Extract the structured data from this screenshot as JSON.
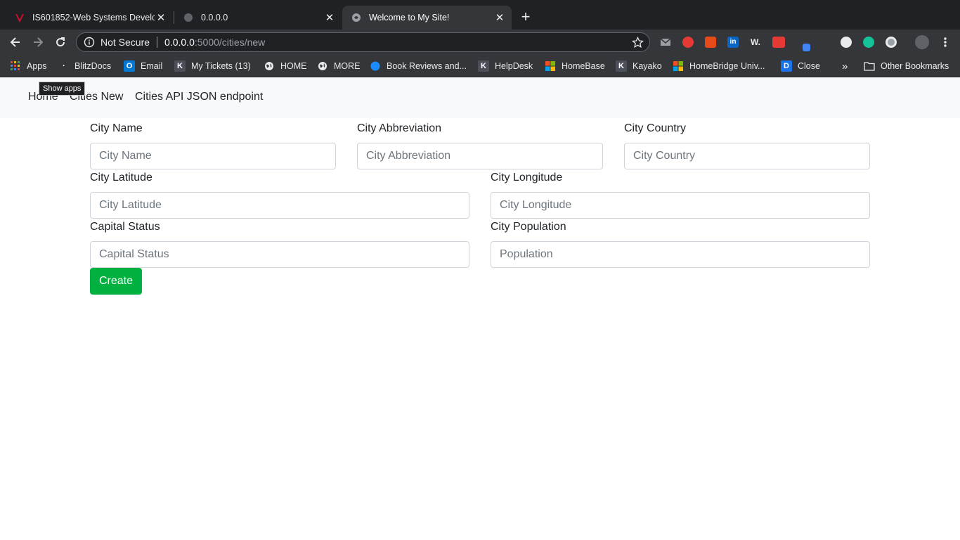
{
  "browser": {
    "tabs": [
      {
        "title": "IS601852-Web Systems Develo",
        "close": "✕"
      },
      {
        "title": "0.0.0.0",
        "close": "✕"
      },
      {
        "title": "Welcome to My Site!",
        "close": "✕"
      }
    ],
    "new_tab_symbol": "+",
    "address": {
      "security": "Not Secure",
      "host": "0.0.0.0",
      "rest": ":5000/cities/new"
    },
    "icons": [
      "back-icon",
      "forward-icon",
      "reload-icon",
      "info-icon",
      "star-icon",
      "menu-icon"
    ],
    "bookmarks": [
      {
        "label": "Apps",
        "icon": "apps-grid-icon"
      },
      {
        "label": "BlitzDocs",
        "icon": "dot-icon"
      },
      {
        "label": "Email",
        "icon": "outlook-icon"
      },
      {
        "label": "My Tickets (13)",
        "icon": "k-icon"
      },
      {
        "label": "HOME",
        "icon": "globe-icon"
      },
      {
        "label": "MORE",
        "icon": "globe-icon"
      },
      {
        "label": "Book Reviews and...",
        "icon": "blue-circle-icon"
      },
      {
        "label": "HelpDesk",
        "icon": "k-icon"
      },
      {
        "label": "HomeBase",
        "icon": "ms-squares-icon"
      },
      {
        "label": "Kayako",
        "icon": "k-icon"
      },
      {
        "label": "HomeBridge Univ...",
        "icon": "ms-squares-icon"
      },
      {
        "label": "Close",
        "icon": "d-icon"
      }
    ],
    "overflow_symbol": "»",
    "other_bookmarks": "Other Bookmarks",
    "tooltip": "Show apps"
  },
  "page": {
    "nav": [
      "Home",
      "Cities New",
      "Cities API JSON endpoint"
    ],
    "form": {
      "city_name": {
        "label": "City Name",
        "placeholder": "City Name"
      },
      "city_abbreviation": {
        "label": "City Abbreviation",
        "placeholder": "City Abbreviation"
      },
      "city_country": {
        "label": "City Country",
        "placeholder": "City Country"
      },
      "city_latitude": {
        "label": "City Latitude",
        "placeholder": "City Latitude"
      },
      "city_longitude": {
        "label": "City Longitude",
        "placeholder": "City Longitude"
      },
      "capital_status": {
        "label": "Capital Status",
        "placeholder": "Capital Status"
      },
      "city_population": {
        "label": "City Population",
        "placeholder": "Population"
      },
      "submit_label": "Create"
    },
    "colors": {
      "create_button": "#00b140",
      "navbar_bg": "#f8f9fa"
    }
  }
}
